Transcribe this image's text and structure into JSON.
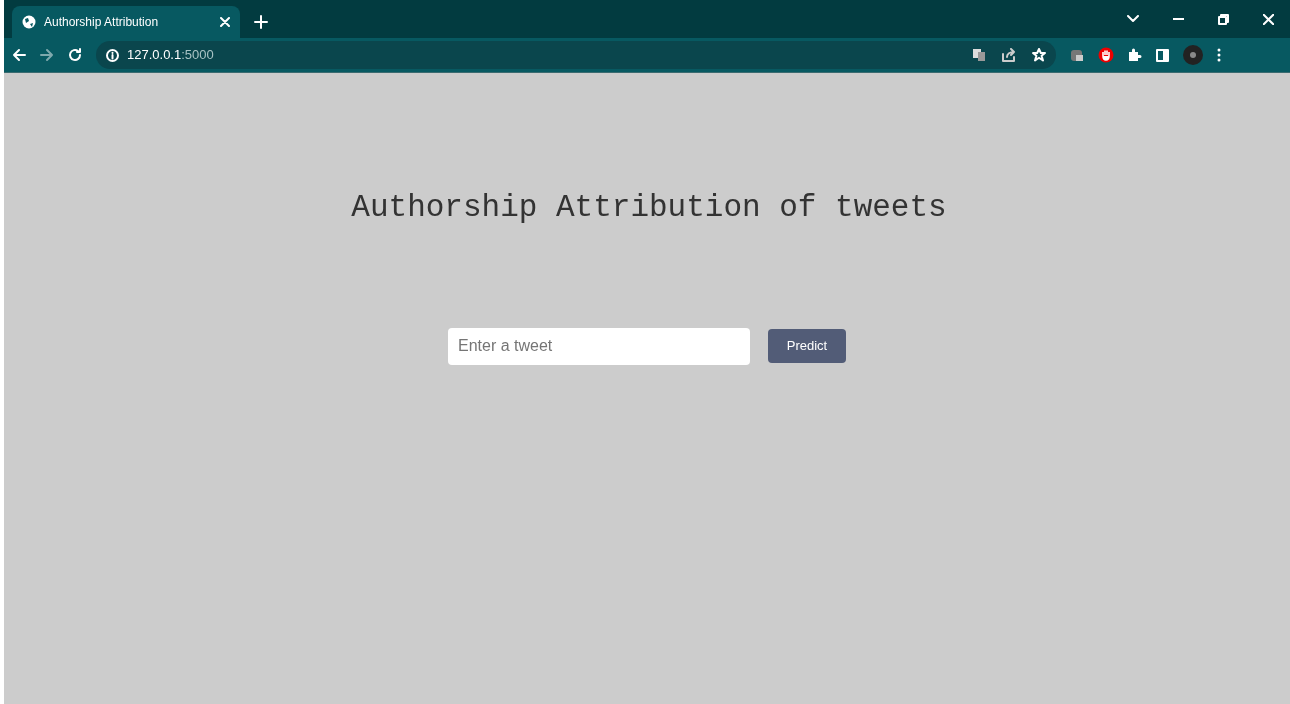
{
  "browser": {
    "tab": {
      "title": "Authorship Attribution",
      "selected": true
    },
    "url_host": "127.0.0.1",
    "url_port": ":5000"
  },
  "page": {
    "heading": "Authorship Attribution of tweets",
    "tweet_field": {
      "placeholder": "Enter a tweet"
    },
    "predict_button": "Predict"
  }
}
